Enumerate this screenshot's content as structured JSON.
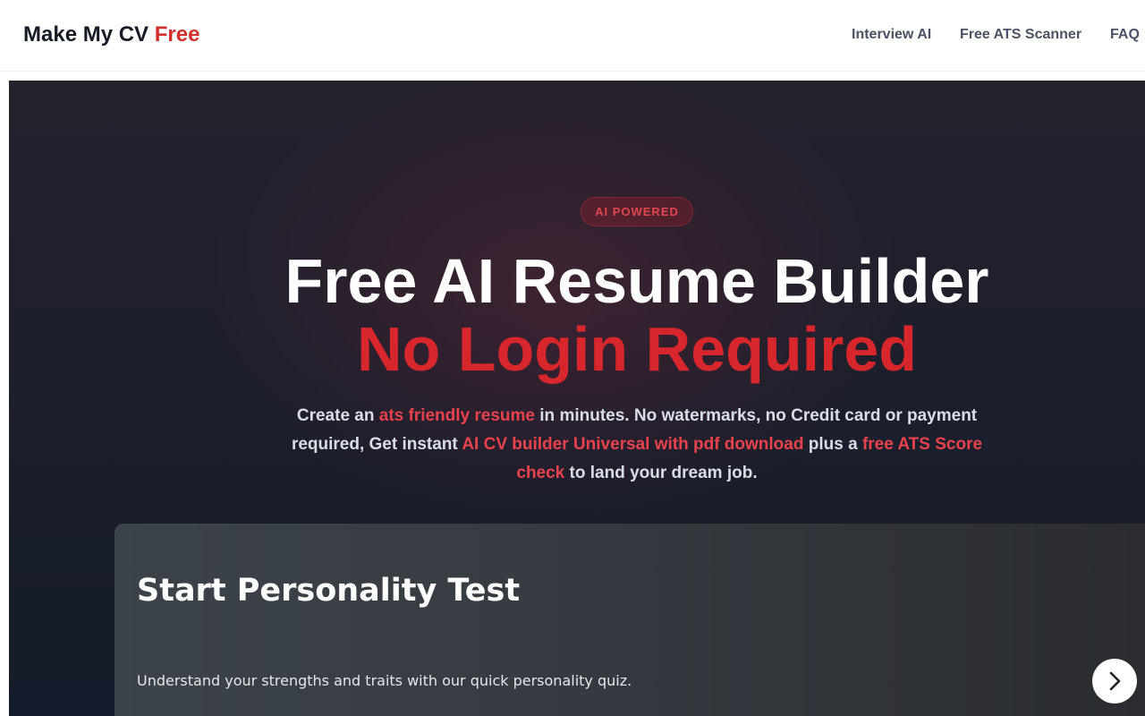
{
  "navbar": {
    "brand": {
      "text": "Make My CV",
      "accent": "Free"
    },
    "links": [
      {
        "label": "Interview AI"
      },
      {
        "label": "Free ATS Scanner"
      },
      {
        "label": "FAQ"
      }
    ]
  },
  "hero": {
    "badge": "AI POWERED",
    "title_line1": "Free AI Resume Builder",
    "title_line2": "No Login Required",
    "subtitle": {
      "t1": "Create an ",
      "h1": "ats friendly resume",
      "t2": " in minutes. No watermarks, no Credit card or payment required, Get instant ",
      "h2": "AI CV builder Universal with pdf download",
      "t3": " plus a ",
      "h3": "free ATS Score check",
      "t4": " to land your dream job."
    }
  },
  "card": {
    "title": "Start Personality Test",
    "description": "Understand your strengths and traits with our quick personality quiz.",
    "next_icon": "chevron-right-icon"
  },
  "colors": {
    "accent": "#d32f2f",
    "hero_bg": "#1b1e2b",
    "card_bg": "#383c42"
  }
}
